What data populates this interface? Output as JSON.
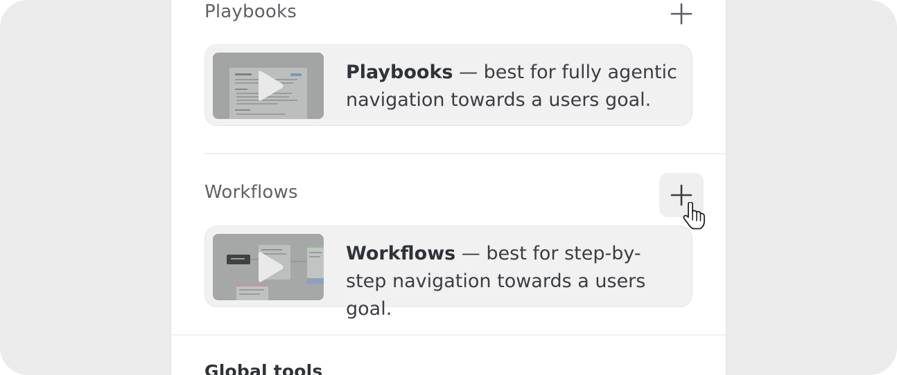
{
  "sections": {
    "playbooks": {
      "title": "Playbooks",
      "card": {
        "title": "Playbooks",
        "description": " — best for fully agentic navigation towards a users goal."
      }
    },
    "workflows": {
      "title": "Workflows",
      "card": {
        "title": "Workflows",
        "description": " — best for step-by-step navigation towards a users goal."
      }
    },
    "global_tools": {
      "title": "Global tools"
    }
  },
  "icons": {
    "add": "plus-icon",
    "play": "play-icon",
    "cursor": "hand-pointer-icon"
  },
  "colors": {
    "background": "#ebebeb",
    "panel": "#ffffff",
    "card": "#f1f1f1",
    "title_text": "#5e6166",
    "body_text": "#3a3d42"
  }
}
